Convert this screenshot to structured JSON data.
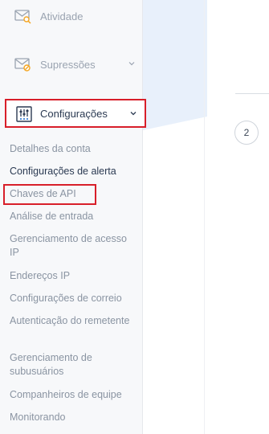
{
  "sidebar": {
    "top_items": [
      {
        "label": "Atividade",
        "icon": "mail-search-icon"
      },
      {
        "label": "Supressões",
        "icon": "mail-block-icon"
      }
    ],
    "config": {
      "label": "Configurações",
      "icon": "sliders-icon",
      "expanded": true
    },
    "sub_items": [
      {
        "label": "Detalhes da conta"
      },
      {
        "label": "Configurações de alerta"
      },
      {
        "label": "Chaves de API"
      },
      {
        "label": "Análise de entrada"
      },
      {
        "label": "Gerenciamento de acesso IP"
      },
      {
        "label": "Endereços IP"
      },
      {
        "label": "Configurações de correio"
      },
      {
        "label": "Autenticação do remetente"
      },
      {
        "label": "Gerenciamento de subusuários"
      },
      {
        "label": "Companheiros de equipe"
      },
      {
        "label": "Monitorando"
      }
    ]
  },
  "main": {
    "step_number": "2"
  },
  "colors": {
    "highlight": "#d81f2a",
    "accent_orange": "#f5a623",
    "accent_blue": "#e8f0fb"
  }
}
